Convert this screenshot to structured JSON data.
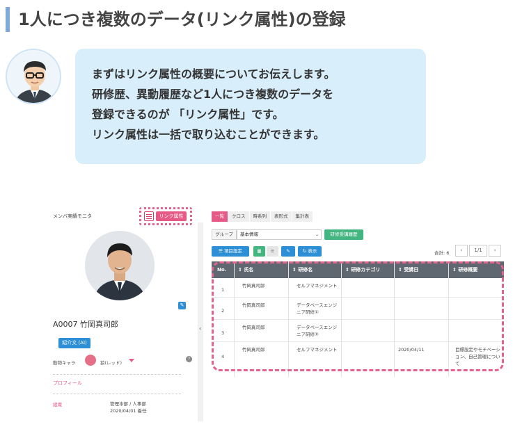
{
  "header": {
    "title": "1人につき複数のデータ(リンク属性)の登録"
  },
  "bubble": {
    "lines": [
      "まずはリンク属性の概要についてお伝えします。",
      "研修歴、異動履歴など1人につき複数のデータを",
      "登録できるのが 「リンク属性」です。",
      "リンク属性は一括で取り込むことができます。"
    ]
  },
  "left": {
    "panel_title": "メンバ実績モニタ",
    "link_button": "リンク属性",
    "employee": "A0007 竹岡真司郎",
    "intro_button": "紹介文 (AI)",
    "animal_label": "動物キャラ",
    "animal_value": "狼(レッド)",
    "profile_label": "プロフィール",
    "org_label": "組織",
    "org_value_1": "管理本部 / 人事部",
    "org_value_2": "2020/04/01 着任"
  },
  "tabs": [
    "一覧",
    "クロス",
    "時系列",
    "表形式",
    "集計表"
  ],
  "group": {
    "label": "グループ",
    "selected": "基本情報",
    "history_button": "研修受講履歴"
  },
  "toolbar": {
    "item_settings": "項目設定",
    "display": "表示",
    "total": "合計: 6",
    "page": "1/1"
  },
  "table": {
    "columns": [
      "No.",
      "氏名",
      "研修名",
      "研修カテゴリ",
      "受講日",
      "研修概要"
    ],
    "rows": [
      {
        "no": "1",
        "name": "竹岡真司郎",
        "course": "セルフマネジメント",
        "category": "",
        "date": "",
        "summary": ""
      },
      {
        "no": "2",
        "name": "竹岡真司郎",
        "course": "データベースエンジニア研修①",
        "category": "",
        "date": "",
        "summary": ""
      },
      {
        "no": "3",
        "name": "竹岡真司郎",
        "course": "データベースエンジニア研修②",
        "category": "",
        "date": "",
        "summary": ""
      },
      {
        "no": "4",
        "name": "竹岡真司郎",
        "course": "セルフマネジメント",
        "category": "",
        "date": "2020/04/11",
        "summary": "目標設定やモチベーション、自己管理について"
      }
    ]
  },
  "colors": {
    "accent": "#e55a87",
    "blue": "#2d8fd6",
    "green": "#43b581",
    "bubble": "#d9eefb"
  }
}
